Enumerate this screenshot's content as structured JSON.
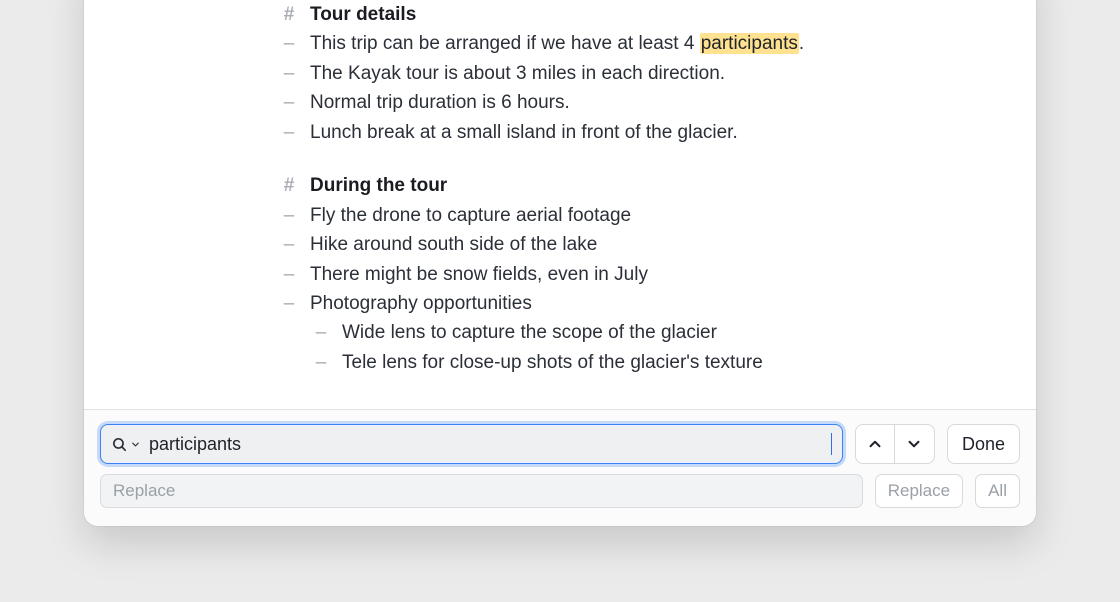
{
  "content": {
    "sections": [
      {
        "heading": "Tour details",
        "items": [
          {
            "pre": "This trip can be arranged if we have at least 4 ",
            "hl": "participants",
            "post": ".",
            "sub": false
          },
          {
            "pre": "The Kayak tour is about 3 miles in each direction.",
            "hl": "",
            "post": "",
            "sub": false
          },
          {
            "pre": "Normal trip duration is 6 hours.",
            "hl": "",
            "post": "",
            "sub": false
          },
          {
            "pre": "Lunch break at a small island in front of the glacier.",
            "hl": "",
            "post": "",
            "sub": false
          }
        ]
      },
      {
        "heading": "During the tour",
        "items": [
          {
            "pre": "Fly the drone to capture aerial footage",
            "hl": "",
            "post": "",
            "sub": false
          },
          {
            "pre": "Hike around south side of the lake",
            "hl": "",
            "post": "",
            "sub": false
          },
          {
            "pre": "There might be snow fields, even in July",
            "hl": "",
            "post": "",
            "sub": false
          },
          {
            "pre": "Photography opportunities",
            "hl": "",
            "post": "",
            "sub": false
          },
          {
            "pre": "Wide lens to capture the scope of the glacier",
            "hl": "",
            "post": "",
            "sub": true
          },
          {
            "pre": "Tele lens for close-up shots of the glacier's texture",
            "hl": "",
            "post": "",
            "sub": true
          }
        ]
      }
    ]
  },
  "find": {
    "query": "participants",
    "replace_placeholder": "Replace",
    "prev_label": "Previous",
    "next_label": "Next",
    "done_label": "Done",
    "replace_label": "Replace",
    "all_label": "All"
  },
  "glyphs": {
    "hash": "#",
    "dash": "–"
  }
}
